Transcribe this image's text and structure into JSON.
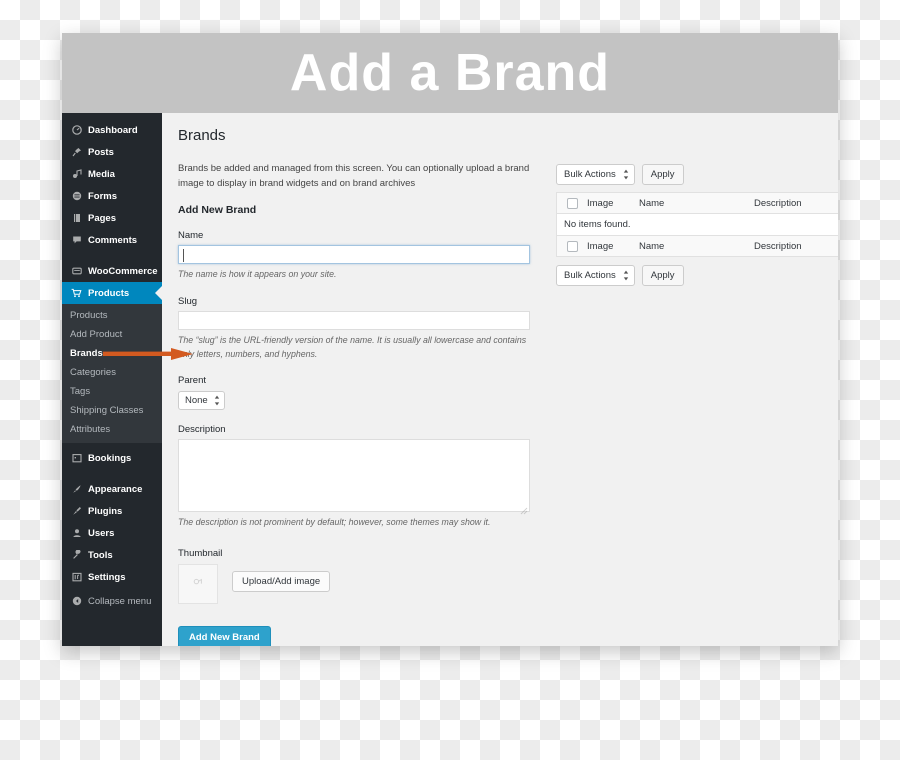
{
  "banner": {
    "title": "Add a Brand",
    "bg": "#c3c3c3",
    "text_color": "#ffffff"
  },
  "accents": {
    "admin_blue": "#0087be",
    "primary_button": "#2ea2cc",
    "arrow_orange": "#d35a20",
    "sidebar_bg": "#23282d",
    "submenu_bg": "#32373c"
  },
  "sidebar": {
    "items": [
      {
        "label": "Dashboard",
        "icon": "dashboard-icon"
      },
      {
        "label": "Posts",
        "icon": "pin-icon"
      },
      {
        "label": "Media",
        "icon": "media-icon"
      },
      {
        "label": "Forms",
        "icon": "forms-icon"
      },
      {
        "label": "Pages",
        "icon": "pages-icon"
      },
      {
        "label": "Comments",
        "icon": "comment-icon"
      },
      {
        "label": "WooCommerce",
        "icon": "woocommerce-icon"
      },
      {
        "label": "Products",
        "icon": "cart-icon",
        "active": true
      }
    ],
    "submenu": [
      {
        "label": "Products"
      },
      {
        "label": "Add Product"
      },
      {
        "label": "Brands",
        "current": true
      },
      {
        "label": "Categories"
      },
      {
        "label": "Tags"
      },
      {
        "label": "Shipping Classes"
      },
      {
        "label": "Attributes"
      }
    ],
    "items_lower": [
      {
        "label": "Bookings",
        "icon": "calendar-icon"
      },
      {
        "label": "Appearance",
        "icon": "brush-icon"
      },
      {
        "label": "Plugins",
        "icon": "plugin-icon"
      },
      {
        "label": "Users",
        "icon": "users-icon"
      },
      {
        "label": "Tools",
        "icon": "wrench-icon"
      },
      {
        "label": "Settings",
        "icon": "settings-icon"
      }
    ],
    "collapse": {
      "label": "Collapse menu",
      "icon": "collapse-icon"
    }
  },
  "page": {
    "heading": "Brands",
    "intro": "Brands be added and managed from this screen. You can optionally upload a brand image to display in brand widgets and on brand archives",
    "section_title": "Add New Brand"
  },
  "form": {
    "name": {
      "label": "Name",
      "value": "",
      "placeholder": "",
      "help": "The name is how it appears on your site."
    },
    "slug": {
      "label": "Slug",
      "value": "",
      "placeholder": "",
      "help": "The “slug” is the URL-friendly version of the name. It is usually all lowercase and contains only letters, numbers, and hyphens."
    },
    "parent": {
      "label": "Parent",
      "selected": "None",
      "options": [
        "None"
      ]
    },
    "description": {
      "label": "Description",
      "value": "",
      "placeholder": "",
      "help": "The description is not prominent by default; however, some themes may show it."
    },
    "thumbnail": {
      "label": "Thumbnail",
      "upload_button": "Upload/Add image",
      "placeholder_icon": "image-placeholder-icon"
    },
    "submit_button": "Add New Brand"
  },
  "list_table": {
    "top_nav": {
      "bulk_selected": "Bulk Actions",
      "apply_label": "Apply"
    },
    "bottom_nav": {
      "bulk_selected": "Bulk Actions",
      "apply_label": "Apply"
    },
    "columns": {
      "image": "Image",
      "name": "Name",
      "description": "Description"
    },
    "empty_message": "No items found."
  },
  "annotation": {
    "arrow": "arrow-pointing-to-brands",
    "color": "#d35a20"
  }
}
